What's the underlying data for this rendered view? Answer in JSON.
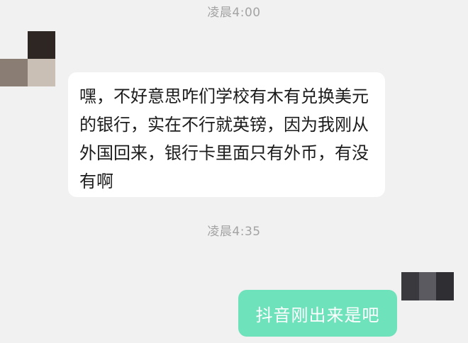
{
  "chat": {
    "timestamp_1": "凌晨4:00",
    "timestamp_2": "凌晨4:35",
    "incoming_message": "嘿，不好意思咋们学校有木有兑换美元的银行，实在不行就英镑，因为我刚从外国回来，银行卡里面只有外币，有没有啊",
    "outgoing_message": "抖音刚出来是吧"
  },
  "colors": {
    "background": "#f1f1f1",
    "incoming_bubble": "#ffffff",
    "outgoing_bubble": "#6ee2ba",
    "timestamp_text": "#a3a3a3"
  }
}
